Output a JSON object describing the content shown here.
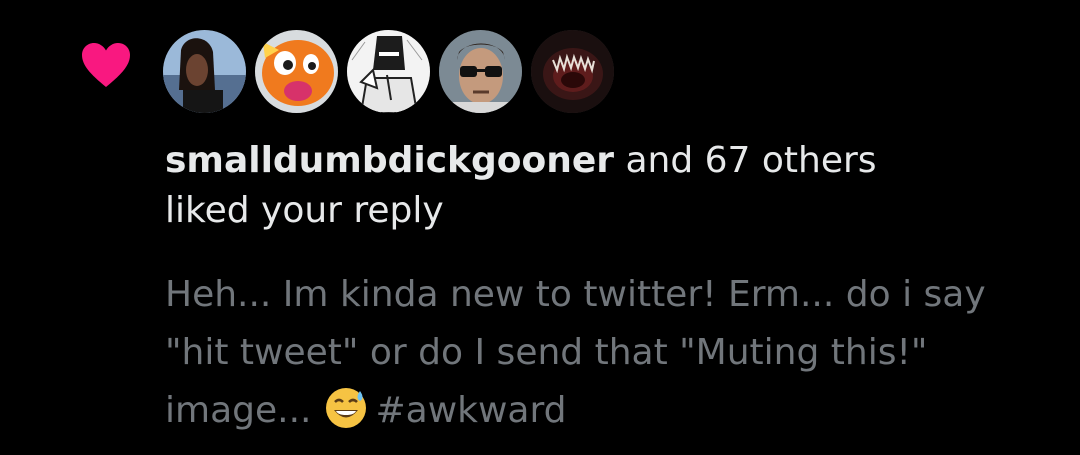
{
  "notification": {
    "icon": "heart-icon",
    "icon_color": "#f91880",
    "avatars": [
      {
        "name": "avatar-1"
      },
      {
        "name": "avatar-2"
      },
      {
        "name": "avatar-3"
      },
      {
        "name": "avatar-4"
      },
      {
        "name": "avatar-5"
      }
    ],
    "username": "smalldumbdickgooner",
    "others_text": " and 67 others",
    "action_text": "liked your reply",
    "reply_text": "Heh... Im kinda new to twitter! Erm... do i say \"hit tweet\" or do I send that \"Muting this!\" image...",
    "emoji": "grinning-sweat-emoji",
    "hashtag": "#awkward",
    "text_color": "#e7e9ea",
    "muted_color": "#71767b"
  }
}
